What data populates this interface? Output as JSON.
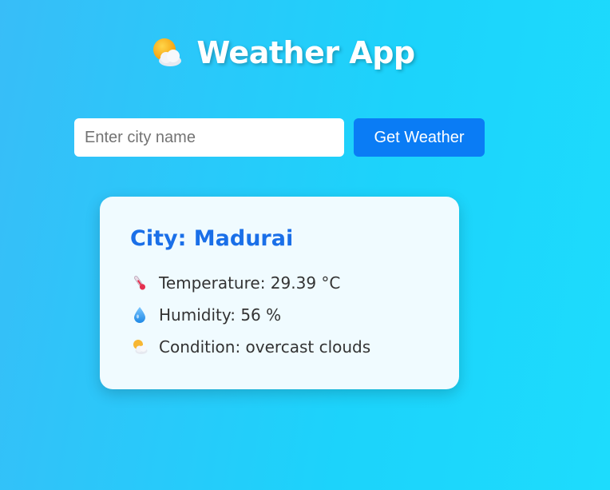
{
  "header": {
    "title": "Weather App",
    "icon": "sun-behind-cloud-icon"
  },
  "search": {
    "placeholder": "Enter city name",
    "value": "",
    "button_label": "Get Weather"
  },
  "weather": {
    "city_line": "City: Madurai",
    "temperature_line": "Temperature: 29.39 °C",
    "temperature_icon": "thermometer-icon",
    "humidity_line": "Humidity: 56 %",
    "humidity_icon": "droplet-icon",
    "condition_line": "Condition: overcast clouds",
    "condition_icon": "sun-behind-cloud-icon"
  },
  "colors": {
    "accent": "#0a7cf5",
    "city_heading": "#1a6fe8",
    "card_bg": "#f0fbff"
  }
}
